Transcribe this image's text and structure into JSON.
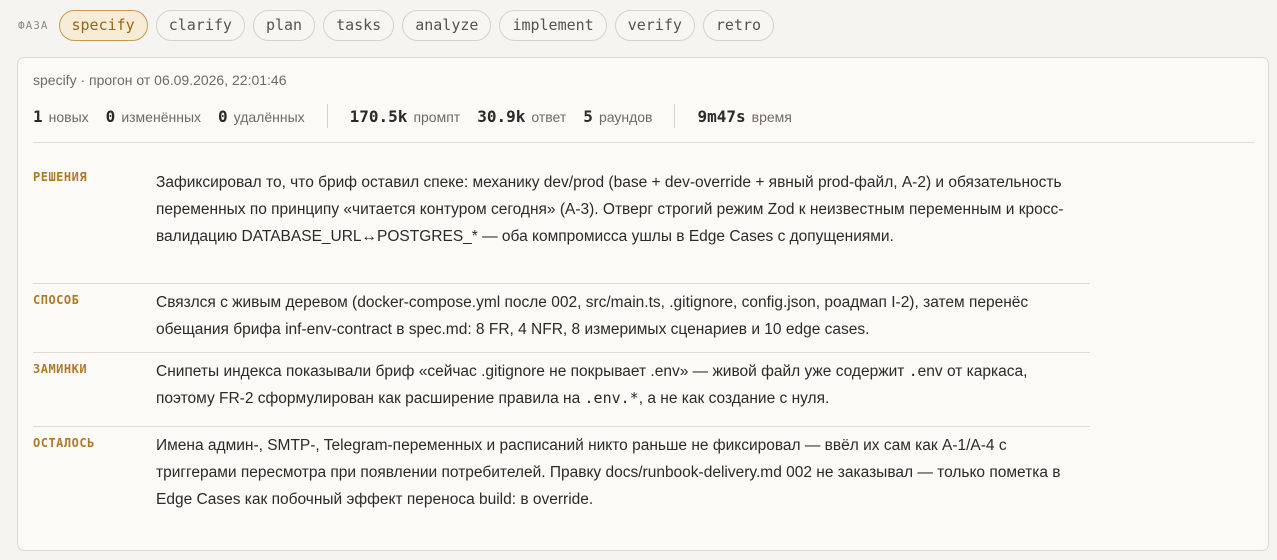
{
  "phase": {
    "label": "ФАЗА",
    "items": [
      "specify",
      "clarify",
      "plan",
      "tasks",
      "analyze",
      "implement",
      "verify",
      "retro"
    ],
    "active": "specify"
  },
  "run": {
    "subtitle": "specify · прогон от 06.09.2026, 22:01:46",
    "stats": [
      {
        "value": "1",
        "unit": "новых"
      },
      {
        "value": "0",
        "unit": "изменённых"
      },
      {
        "value": "0",
        "unit": "удалённых"
      },
      {
        "value": "170.5k",
        "unit": "промпт"
      },
      {
        "value": "30.9k",
        "unit": "ответ"
      },
      {
        "value": "5",
        "unit": "раундов"
      },
      {
        "value": "9m47s",
        "unit": "время"
      }
    ]
  },
  "sections": {
    "decisions": {
      "label": "РЕШЕНИЯ",
      "text": "Зафиксировал то, что бриф оставил спеке: механику dev/prod (base + dev-override + явный prod-файл, A-2) и обязательность переменных по принципу «читается контуром сегодня» (A-3). Отверг строгий режим Zod к неизвестным переменным и кросс-валидацию DATABASE_URL↔POSTGRES_* — оба компромисса ушлы в Edge Cases с допущениями."
    },
    "method": {
      "label": "СПОСОБ",
      "text": "Связлся с живым деревом (docker-compose.yml после 002, src/main.ts, .gitignore, config.json, роадмап I-2), затем перенёс обещания брифа inf-env-contract в spec.md: 8 FR, 4 NFR, 8 измеримых сценариев и 10 edge cases."
    },
    "hitches": {
      "label": "ЗАМИНКИ",
      "text_a": "Снипеты индекса показывали бриф «сейчас .gitignore не покрывает .env» — живой файл уже содержит ",
      "code_a": ".",
      "text_b": "env от каркаса, поэтому FR-2 сформулирован как расширение правила на ",
      "code_b": ".env.*",
      "text_c": ", а не как создание с нуля."
    },
    "remaining": {
      "label": "ОСТАЛОСЬ",
      "text": "Имена админ-, SMTP-, Telegram-переменных и расписаний никто раньше не фиксировал — ввёл их сам как A-1/A-4 с триггерами пересмотра при появлении потребителей. Правку docs/runbook-delivery.md 002 не заказывал — только пометка в Edge Cases как побочный эффект переноса build: в override."
    }
  },
  "colors": {
    "accent": "#b07a2a",
    "active_pill_bg": "#f7ecd7",
    "active_pill_border": "#c99a52"
  }
}
